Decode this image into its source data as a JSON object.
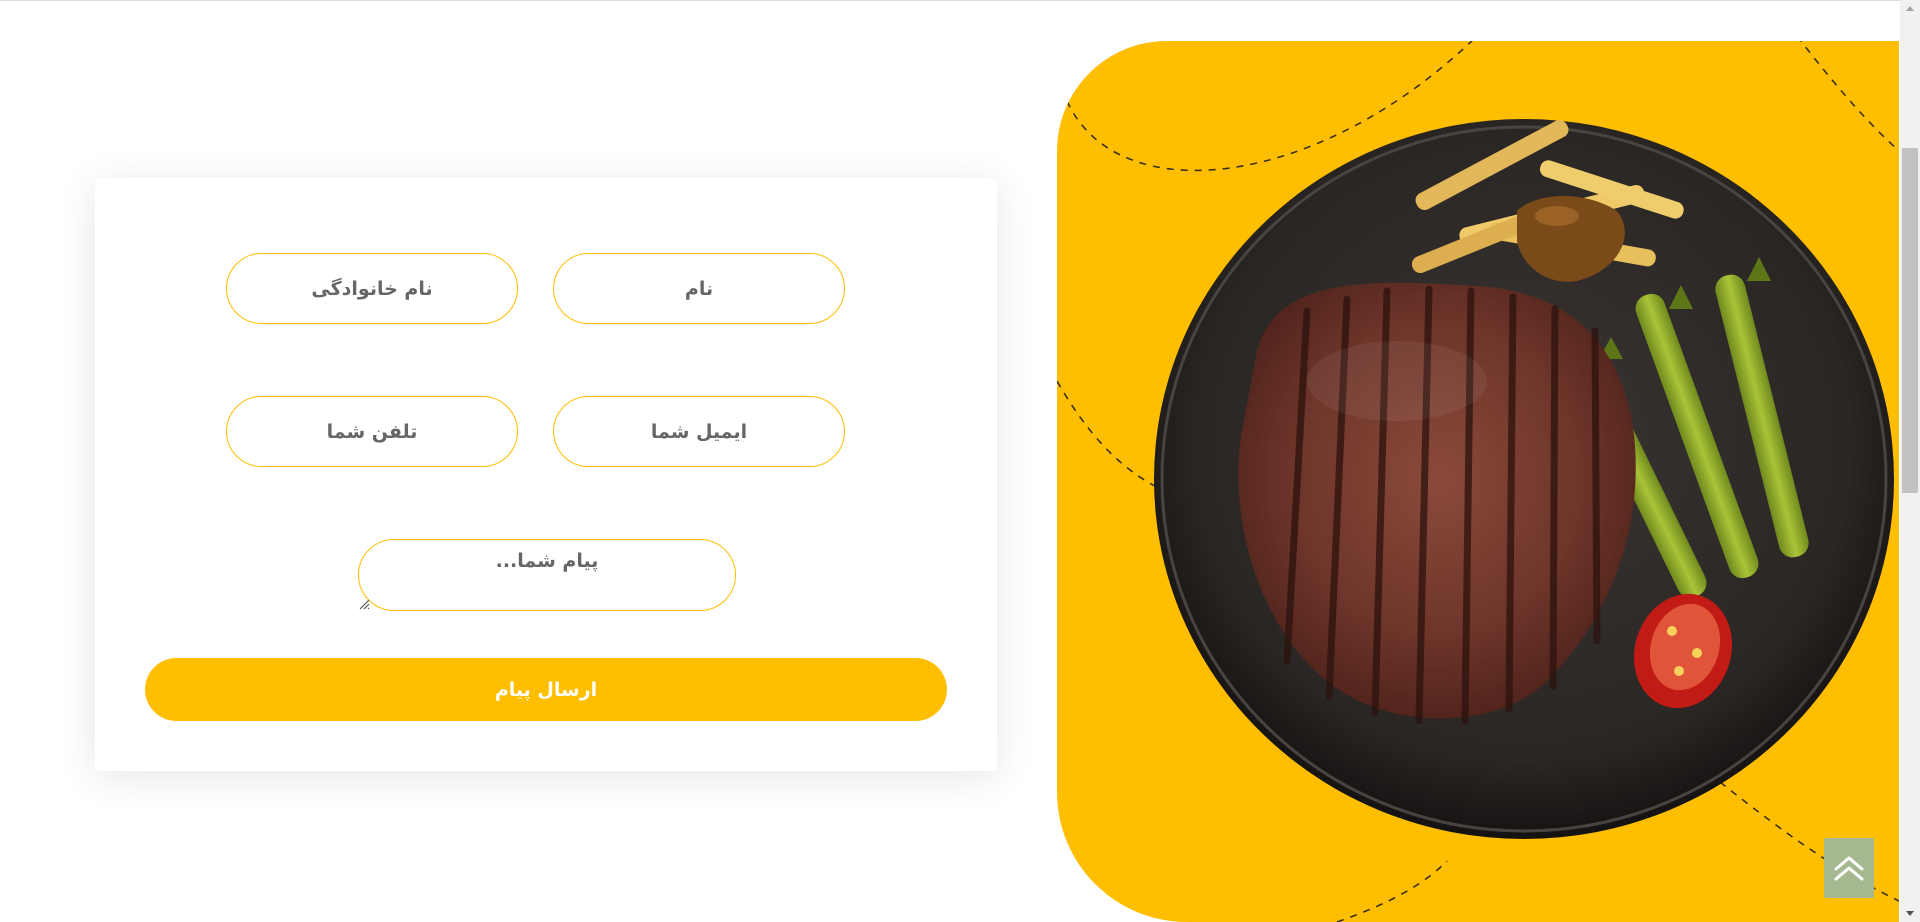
{
  "form": {
    "first_name_placeholder": "نام",
    "last_name_placeholder": "نام خانوادگی",
    "email_placeholder": "ایمیل شما",
    "phone_placeholder": "تلفن شما",
    "message_placeholder": "پیام شما...",
    "send_label": "ارسال پیام"
  },
  "hero_image": {
    "icon": "grilled-steak-plate-image"
  },
  "back_to_top": {
    "icon": "double-chevron-up-icon"
  },
  "colors": {
    "accent": "#ffbe00",
    "field_text": "#666666",
    "back_to_top_bg": "#a6b890"
  }
}
